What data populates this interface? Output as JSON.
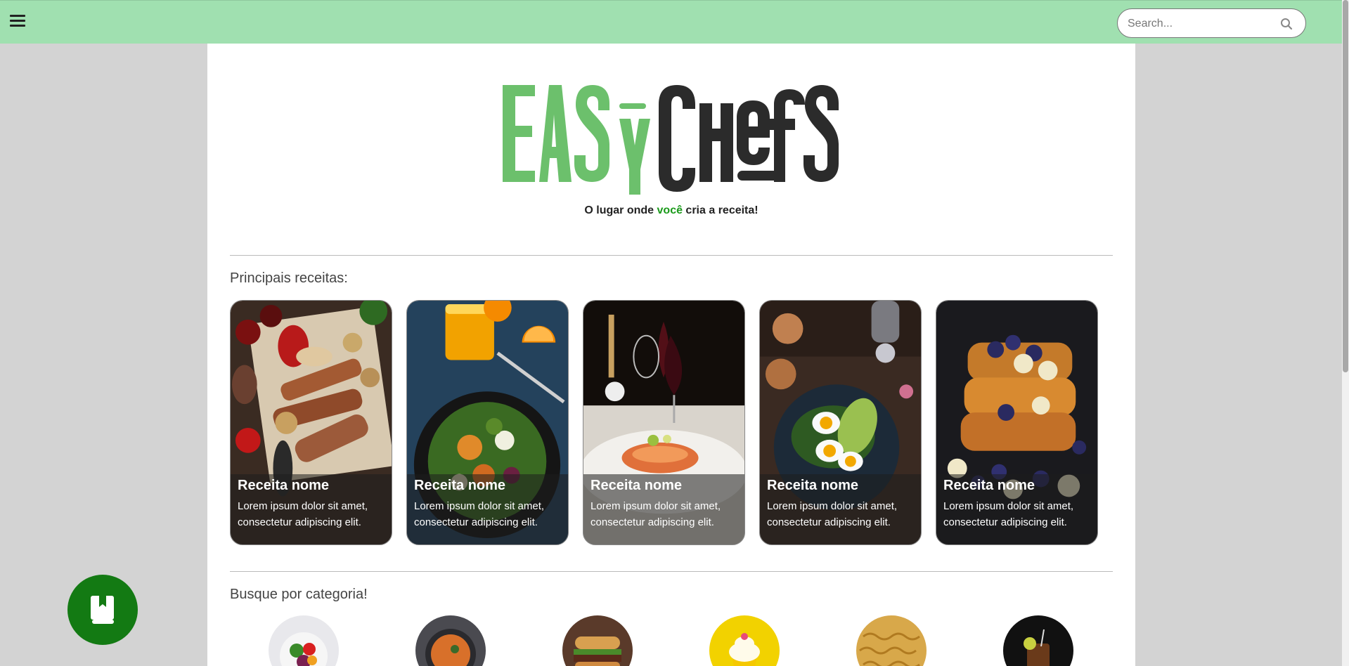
{
  "header": {
    "search_placeholder": "Search..."
  },
  "logo": {
    "text_part1": "EASY",
    "text_part2": "CHEFS",
    "color_part1": "#6cc06c",
    "color_part2": "#2b2b2b"
  },
  "tagline": {
    "before": "O lugar onde ",
    "accent": "você",
    "after": " cria a receita!",
    "accent_color": "#1a9a1a"
  },
  "sections": {
    "top_recipes_title": "Principais receitas:",
    "categories_title": "Busque por categoria!"
  },
  "recipes": [
    {
      "title": "Receita nome",
      "description": "Lorem ipsum dolor sit amet, consectetur adipiscing elit.",
      "image": "grilled-meat-platter"
    },
    {
      "title": "Receita nome",
      "description": "Lorem ipsum dolor sit amet, consectetur adipiscing elit.",
      "image": "salad-with-orange-juice"
    },
    {
      "title": "Receita nome",
      "description": "Lorem ipsum dolor sit amet, consectetur adipiscing elit.",
      "image": "salmon-with-wine"
    },
    {
      "title": "Receita nome",
      "description": "Lorem ipsum dolor sit amet, consectetur adipiscing elit.",
      "image": "avocado-egg-toast"
    },
    {
      "title": "Receita nome",
      "description": "Lorem ipsum dolor sit amet, consectetur adipiscing elit.",
      "image": "french-toast-berries"
    }
  ],
  "categories": [
    {
      "image": "salad-bowl"
    },
    {
      "image": "soup"
    },
    {
      "image": "burger"
    },
    {
      "image": "cupcake-dessert"
    },
    {
      "image": "pasta"
    },
    {
      "image": "iced-drink"
    }
  ],
  "colors": {
    "header_bg": "#a0e0b0",
    "fab_bg": "#137a13",
    "page_bg": "#d3d3d3"
  },
  "icons": {
    "menu": "hamburger-icon",
    "search": "search-icon",
    "fab": "recipe-book-icon"
  }
}
